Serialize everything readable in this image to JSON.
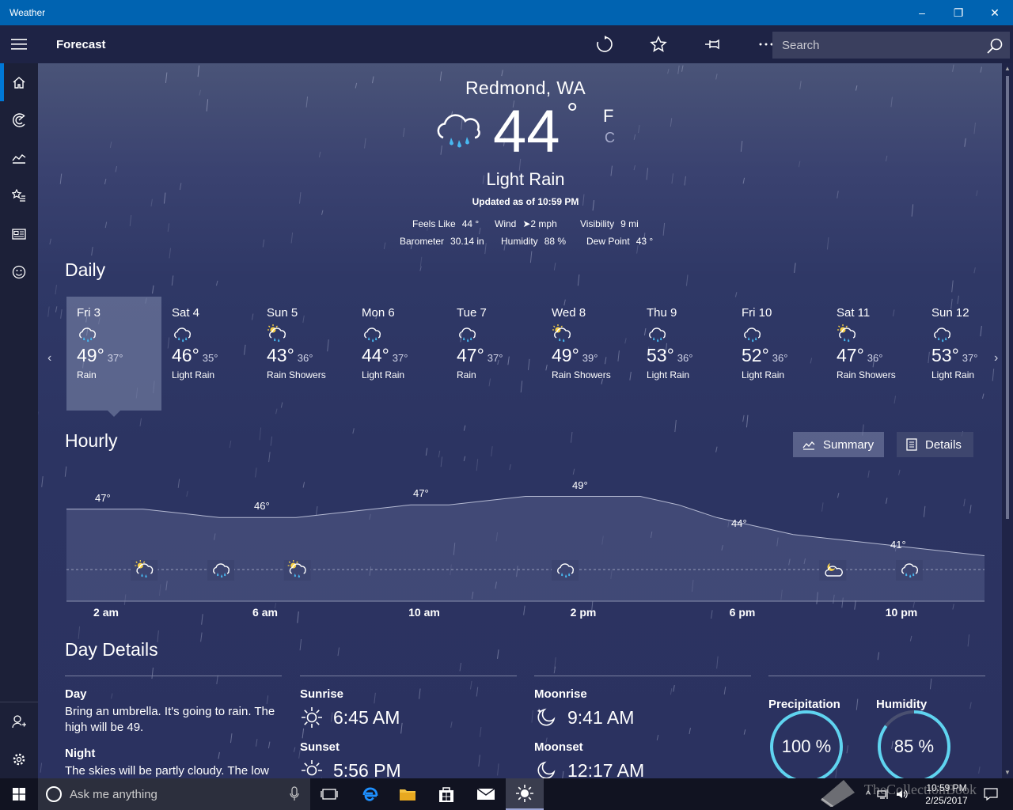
{
  "window": {
    "title": "Weather",
    "minimize": "–",
    "restore": "❐",
    "close": "✕"
  },
  "appbar": {
    "page_title": "Forecast",
    "search_placeholder": "Search"
  },
  "current": {
    "city": "Redmond, WA",
    "temperature": "44",
    "degree": "°",
    "unit_f": "F",
    "unit_c": "C",
    "condition": "Light Rain",
    "updated": "Updated as of 10:59 PM",
    "stats": {
      "feels_like_label": "Feels Like",
      "feels_like": "44 °",
      "wind_label": "Wind",
      "wind": "2 mph",
      "visibility_label": "Visibility",
      "visibility": "9 mi",
      "barometer_label": "Barometer",
      "barometer": "30.14 in",
      "humidity_label": "Humidity",
      "humidity": "88 %",
      "dew_point_label": "Dew Point",
      "dew_point": "43 °"
    }
  },
  "daily": {
    "title": "Daily",
    "days": [
      {
        "name": "Fri 3",
        "hi": "49°",
        "lo": "37°",
        "cond": "Rain",
        "icon": "rain-cloud-icon"
      },
      {
        "name": "Sat 4",
        "hi": "46°",
        "lo": "35°",
        "cond": "Light Rain",
        "icon": "rain-cloud-icon"
      },
      {
        "name": "Sun 5",
        "hi": "43°",
        "lo": "36°",
        "cond": "Rain Showers",
        "icon": "sun-rain-icon"
      },
      {
        "name": "Mon 6",
        "hi": "44°",
        "lo": "37°",
        "cond": "Light Rain",
        "icon": "rain-cloud-icon"
      },
      {
        "name": "Tue 7",
        "hi": "47°",
        "lo": "37°",
        "cond": "Rain",
        "icon": "rain-cloud-icon"
      },
      {
        "name": "Wed 8",
        "hi": "49°",
        "lo": "39°",
        "cond": "Rain Showers",
        "icon": "sun-rain-icon"
      },
      {
        "name": "Thu 9",
        "hi": "53°",
        "lo": "36°",
        "cond": "Light Rain",
        "icon": "rain-cloud-icon"
      },
      {
        "name": "Fri 10",
        "hi": "52°",
        "lo": "36°",
        "cond": "Light Rain",
        "icon": "rain-cloud-icon"
      },
      {
        "name": "Sat 11",
        "hi": "47°",
        "lo": "36°",
        "cond": "Rain Showers",
        "icon": "sun-rain-icon"
      },
      {
        "name": "Sun 12",
        "hi": "53°",
        "lo": "37°",
        "cond": "Light Rain",
        "icon": "rain-cloud-icon"
      }
    ]
  },
  "hourly": {
    "title": "Hourly",
    "summary_label": "Summary",
    "details_label": "Details",
    "time_labels": [
      "2 am",
      "6 am",
      "10 am",
      "2 pm",
      "6 pm",
      "10 pm"
    ],
    "temp_labels": [
      "47°",
      "46°",
      "47°",
      "49°",
      "44°",
      "41°"
    ],
    "temperatures": [
      47,
      47,
      47,
      46.5,
      46,
      46,
      46,
      46.5,
      47,
      47.5,
      47.5,
      48,
      48.5,
      48.5,
      48.5,
      48.5,
      47.5,
      46,
      45,
      44,
      43.5,
      43,
      42.5,
      42,
      41.5
    ]
  },
  "day_details": {
    "title": "Day Details",
    "day_label": "Day",
    "day_text": "Bring an umbrella. It's going to rain. The high will be 49.",
    "night_label": "Night",
    "night_text": "The skies will be partly cloudy. The low",
    "sunrise_label": "Sunrise",
    "sunrise": "6:45 AM",
    "sunset_label": "Sunset",
    "sunset": "5:56 PM",
    "moonrise_label": "Moonrise",
    "moonrise": "9:41 AM",
    "moonset_label": "Moonset",
    "moonset": "12:17 AM",
    "precipitation_label": "Precipitation",
    "precipitation": "100 %",
    "precipitation_value": 100,
    "humidity_label": "Humidity",
    "humidity": "85 %",
    "humidity_value": 85
  },
  "taskbar": {
    "search_placeholder": "Ask me anything",
    "time": "10:59 PM",
    "date": "2/25/2017"
  },
  "watermark": "TheCollectionBook",
  "colors": {
    "accent": "#0078d7",
    "titlebar": "#0063b1",
    "ring": "#5fd4f0"
  }
}
